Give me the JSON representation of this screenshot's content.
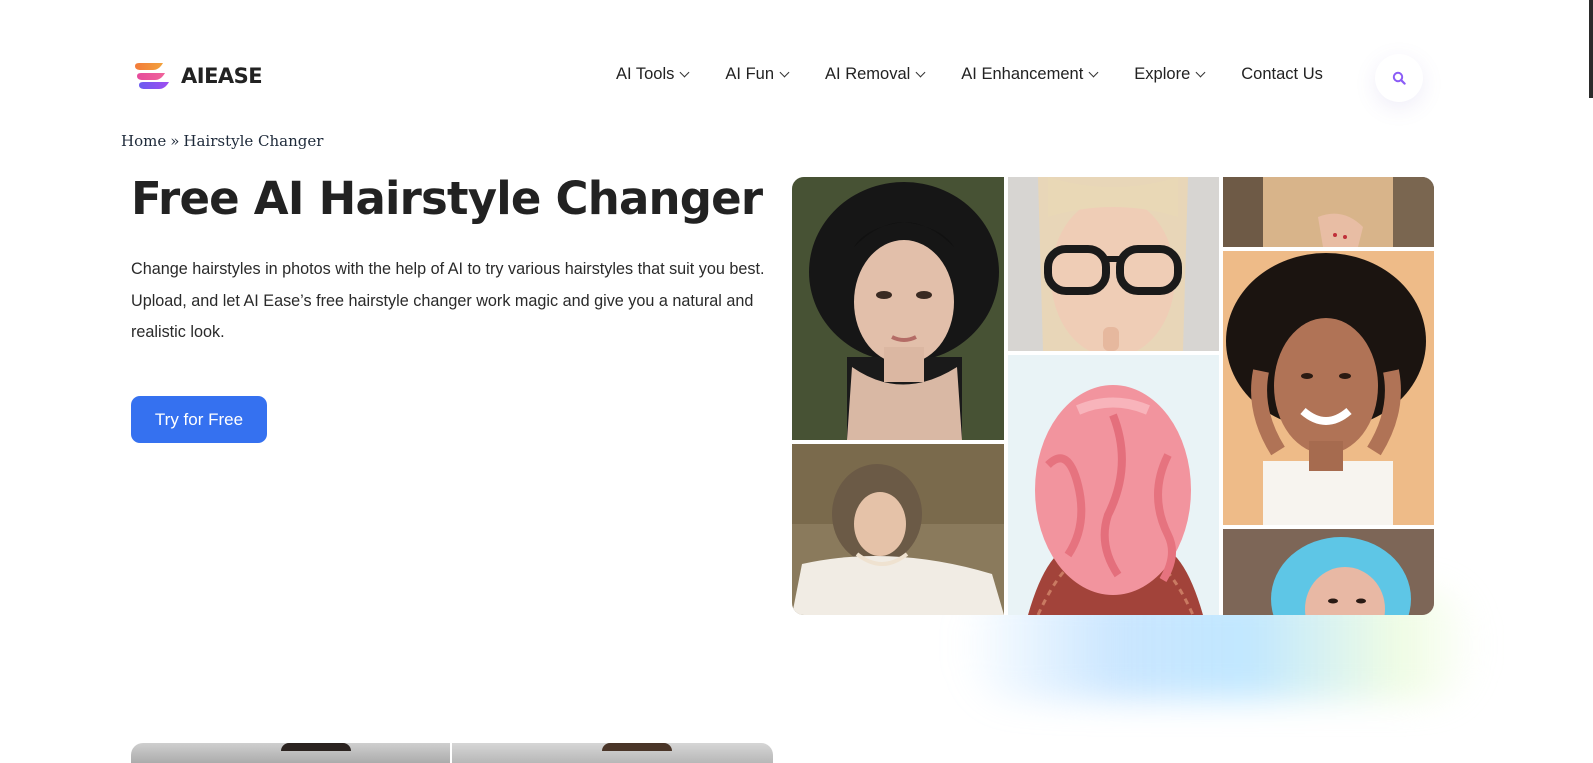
{
  "brand": {
    "name": "AIEASE",
    "colors": {
      "logo_orange": "#f37b3a",
      "logo_pink": "#e64b9c",
      "logo_purple": "#8a4df0",
      "text": "#222222"
    }
  },
  "nav": {
    "items": [
      {
        "label": "AI Tools",
        "has_dropdown": true
      },
      {
        "label": "AI Fun",
        "has_dropdown": true
      },
      {
        "label": "AI Removal",
        "has_dropdown": true
      },
      {
        "label": "AI Enhancement",
        "has_dropdown": true
      },
      {
        "label": "Explore",
        "has_dropdown": true
      },
      {
        "label": "Contact Us",
        "has_dropdown": false
      }
    ],
    "search_icon": "search-icon",
    "search_icon_color": "#8b5cf6"
  },
  "breadcrumb": {
    "home": "Home",
    "separator": "»",
    "current": "Hairstyle Changer"
  },
  "hero": {
    "title": "Free AI Hairstyle Changer",
    "description": "Change hairstyles in photos with the help of AI to try various hairstyles that suit you best. Upload, and let AI Ease’s free hairstyle changer work magic and give you a natural and realistic look.",
    "cta_label": "Try for Free",
    "cta_color": "#3571f0"
  },
  "gallery": {
    "images": [
      {
        "name": "curly-dark-hair-portrait"
      },
      {
        "name": "blonde-glasses-portrait"
      },
      {
        "name": "plaid-jacket-crop"
      },
      {
        "name": "wavy-hair-lying-in-grass"
      },
      {
        "name": "pink-wavy-hair-back-view"
      },
      {
        "name": "smiling-curly-hair-portrait"
      },
      {
        "name": "blue-hair-portrait"
      }
    ]
  }
}
